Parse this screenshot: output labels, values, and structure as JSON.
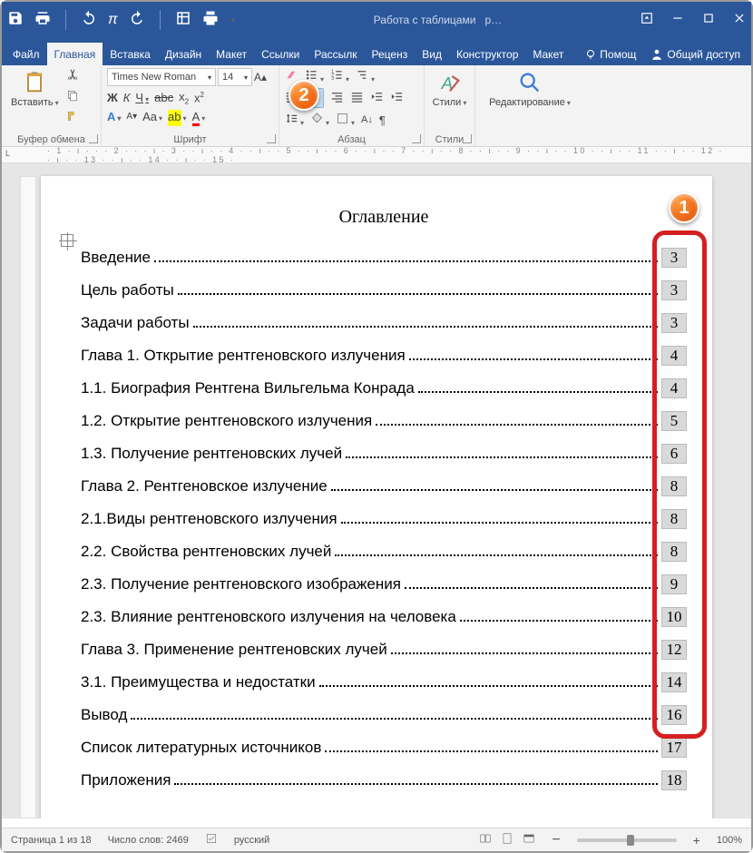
{
  "titlebar": {
    "context_title": "Работа с таблицами",
    "doc_title": "р…"
  },
  "tabs": {
    "file": "Файл",
    "items": [
      "Главная",
      "Вставка",
      "Дизайн",
      "Макет",
      "Ссылки",
      "Рассылк",
      "Реценз",
      "Вид",
      "Конструктор",
      "Макет"
    ],
    "active_index": 0,
    "help": "Помощ",
    "share": "Общий доступ"
  },
  "ribbon": {
    "clipboard": {
      "paste": "Вставить",
      "label": "Буфер обмена"
    },
    "font": {
      "name": "Times New Roman",
      "size": "14",
      "label": "Шрифт"
    },
    "paragraph": {
      "label": "Абзац"
    },
    "styles": {
      "btn": "Стили",
      "label": "Стили"
    },
    "editing": {
      "btn": "Редактирование"
    }
  },
  "document": {
    "title": "Оглавление",
    "toc": [
      {
        "text": "Введение",
        "page": "3"
      },
      {
        "text": " Цель работы",
        "page": "3"
      },
      {
        "text": "Задачи работы",
        "page": "3"
      },
      {
        "text": "Глава 1. Открытие рентгеновского излучения",
        "page": "4"
      },
      {
        "text": "1.1. Биография Рентгена Вильгельма Конрада",
        "page": "4"
      },
      {
        "text": "1.2. Открытие рентгеновского излучения ",
        "page": "5"
      },
      {
        "text": "1.3. Получение рентгеновских лучей",
        "page": "6"
      },
      {
        "text": "Глава 2. Рентгеновское излучение",
        "page": "8"
      },
      {
        "text": "2.1.Виды рентгеновского излучения",
        "page": "8"
      },
      {
        "text": "2.2. Свойства рентгеновских лучей",
        "page": "8"
      },
      {
        "text": "2.3. Получение рентгеновского изображения",
        "page": "9"
      },
      {
        "text": "2.3. Влияние рентгеновского излучения на человека",
        "page": "10"
      },
      {
        "text": "Глава 3. Применение рентгеновских лучей",
        "page": "12"
      },
      {
        "text": "3.1. Преимущества и недостатки",
        "page": "14"
      },
      {
        "text": "Вывод",
        "page": "16"
      },
      {
        "text": "Список литературных источников",
        "page": "17"
      },
      {
        "text": "Приложения",
        "page": "18"
      }
    ]
  },
  "callouts": {
    "one": "1",
    "two": "2"
  },
  "statusbar": {
    "page": "Страница 1 из 18",
    "words": "Число слов: 2469",
    "lang": "русский",
    "zoom": "100%"
  },
  "ruler": {
    "marks": "· 1 · ı · · · 2 · · · ı · 3 · · ı · · 4 · · ı · · 5 · · ı · · 6 · · ı · · 7 · · ı · · 8 · · ı · · 9 · · ı · · 10 · · ı · · 11 · · ı · · 12 · · ı · · 13 · · ı · · 14 · · ı · · 15 ·"
  }
}
